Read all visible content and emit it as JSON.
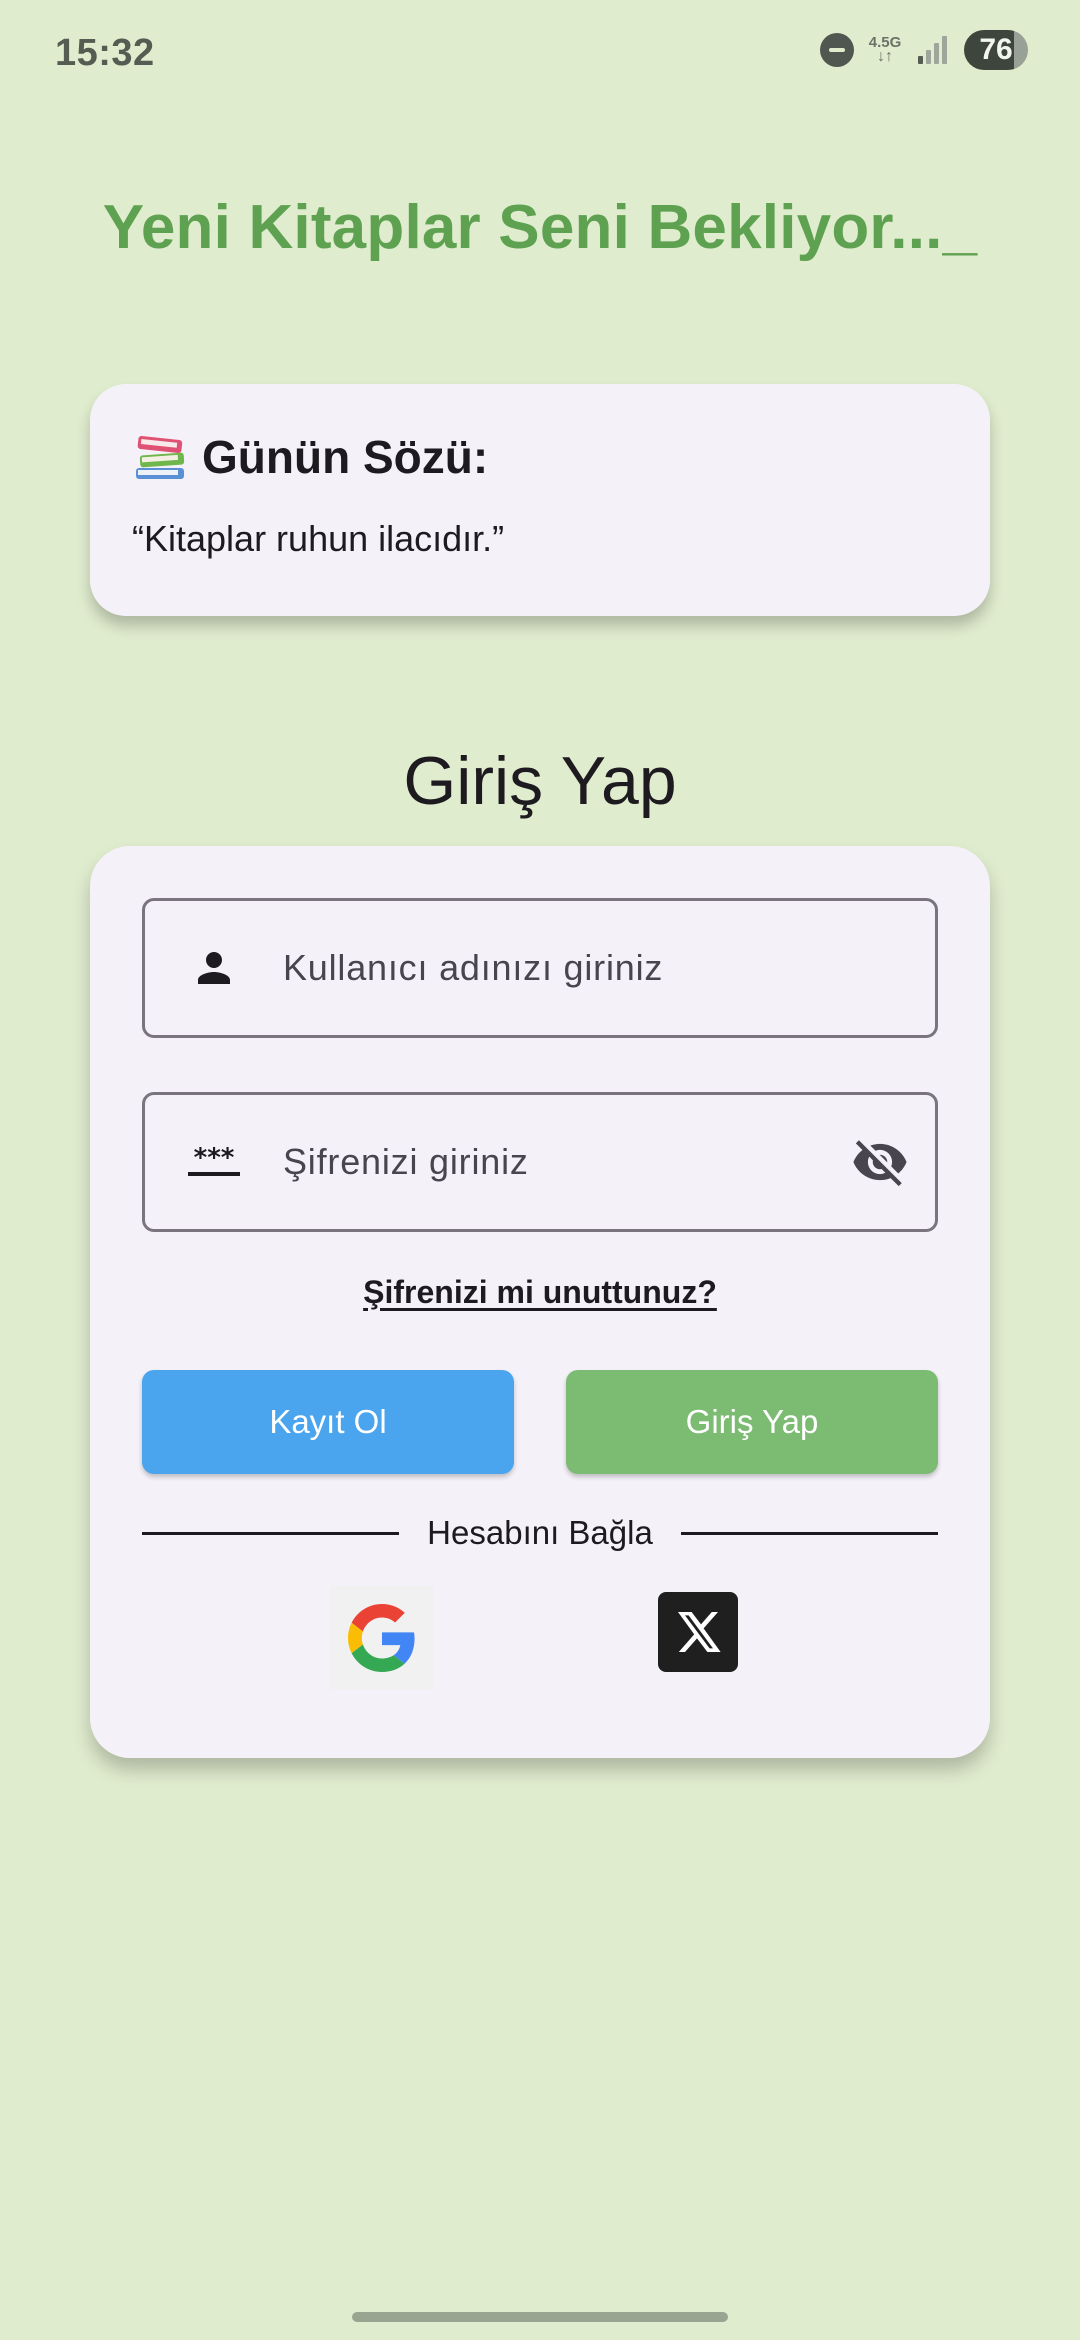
{
  "status_bar": {
    "time": "15:32",
    "network": "4.5G",
    "battery": "76",
    "icons": [
      "do-not-disturb-icon",
      "network-activity-icon",
      "signal-icon",
      "battery-icon"
    ]
  },
  "headline": "Yeni Kitaplar Seni Bekliyor..._",
  "quote_card": {
    "icon": "books-icon",
    "title": "Günün Sözü:",
    "text": "“Kitaplar ruhun ilacıdır.”"
  },
  "login": {
    "title": "Giriş Yap",
    "username": {
      "icon": "person-icon",
      "placeholder": "Kullanıcı adınızı giriniz",
      "value": ""
    },
    "password": {
      "icon": "password-icon",
      "placeholder": "Şifrenizi giriniz",
      "value": "",
      "toggle_icon": "eye-off-icon"
    },
    "forgot_label": "Şifrenizi mi unuttunuz?",
    "register_label": "Kayıt Ol",
    "login_label": "Giriş Yap",
    "divider_label": "Hesabını Bağla",
    "social": [
      "google-icon",
      "x-icon"
    ]
  },
  "colors": {
    "background": "#e0ecce",
    "headline": "#5ea251",
    "card": "#f4f2f8",
    "register_button": "#4aa4ee",
    "login_button": "#7bbb72"
  }
}
